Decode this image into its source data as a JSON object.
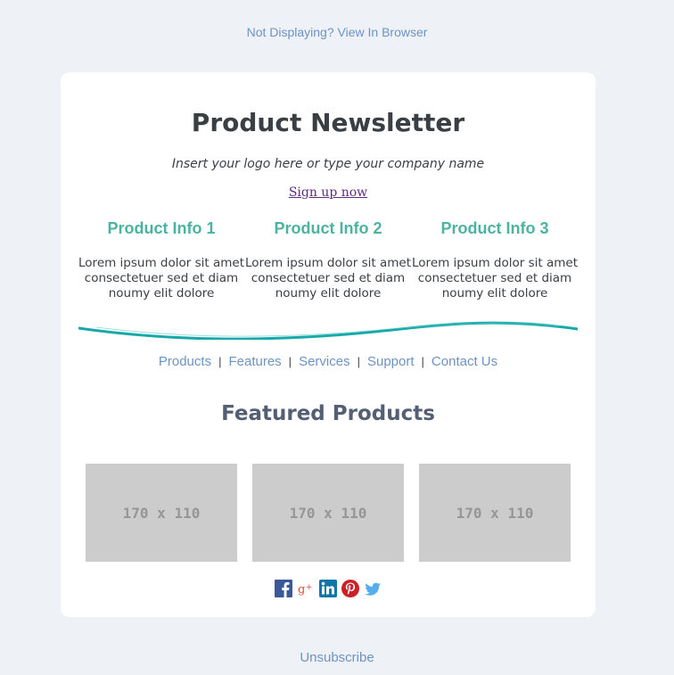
{
  "header": {
    "view_in_browser": "Not Displaying? View In Browser"
  },
  "newsletter": {
    "title": "Product Newsletter",
    "tagline": "Insert your logo here or type your company name",
    "signup": "Sign up now"
  },
  "info_columns": [
    {
      "heading": "Product Info 1",
      "body": "Lorem ipsum dolor sit amet\nconsectetuer sed et diam\nnoumy elit dolore"
    },
    {
      "heading": "Product Info 2",
      "body": "Lorem ipsum dolor sit amet\nconsectetuer sed et diam\nnoumy elit dolore"
    },
    {
      "heading": "Product Info 3",
      "body": "Lorem ipsum dolor sit amet\nconsectetuer sed et diam\nnoumy elit dolore"
    }
  ],
  "nav": {
    "items": [
      "Products",
      "Features",
      "Services",
      "Support",
      "Contact Us"
    ],
    "separator": "|"
  },
  "featured": {
    "title": "Featured Products",
    "placeholders": [
      "170 x 110",
      "170 x 110",
      "170 x 110"
    ]
  },
  "social_icons": [
    "facebook-icon",
    "google-plus-icon",
    "linkedin-icon",
    "pinterest-icon",
    "twitter-icon"
  ],
  "footer": {
    "unsubscribe": "Unsubscribe"
  },
  "colors": {
    "background": "#eef2f7",
    "card": "#ffffff",
    "link": "#6c93c4",
    "accent": "#4cb3a1",
    "wave": "#17a9a9",
    "placeholder": "#cccccc"
  }
}
